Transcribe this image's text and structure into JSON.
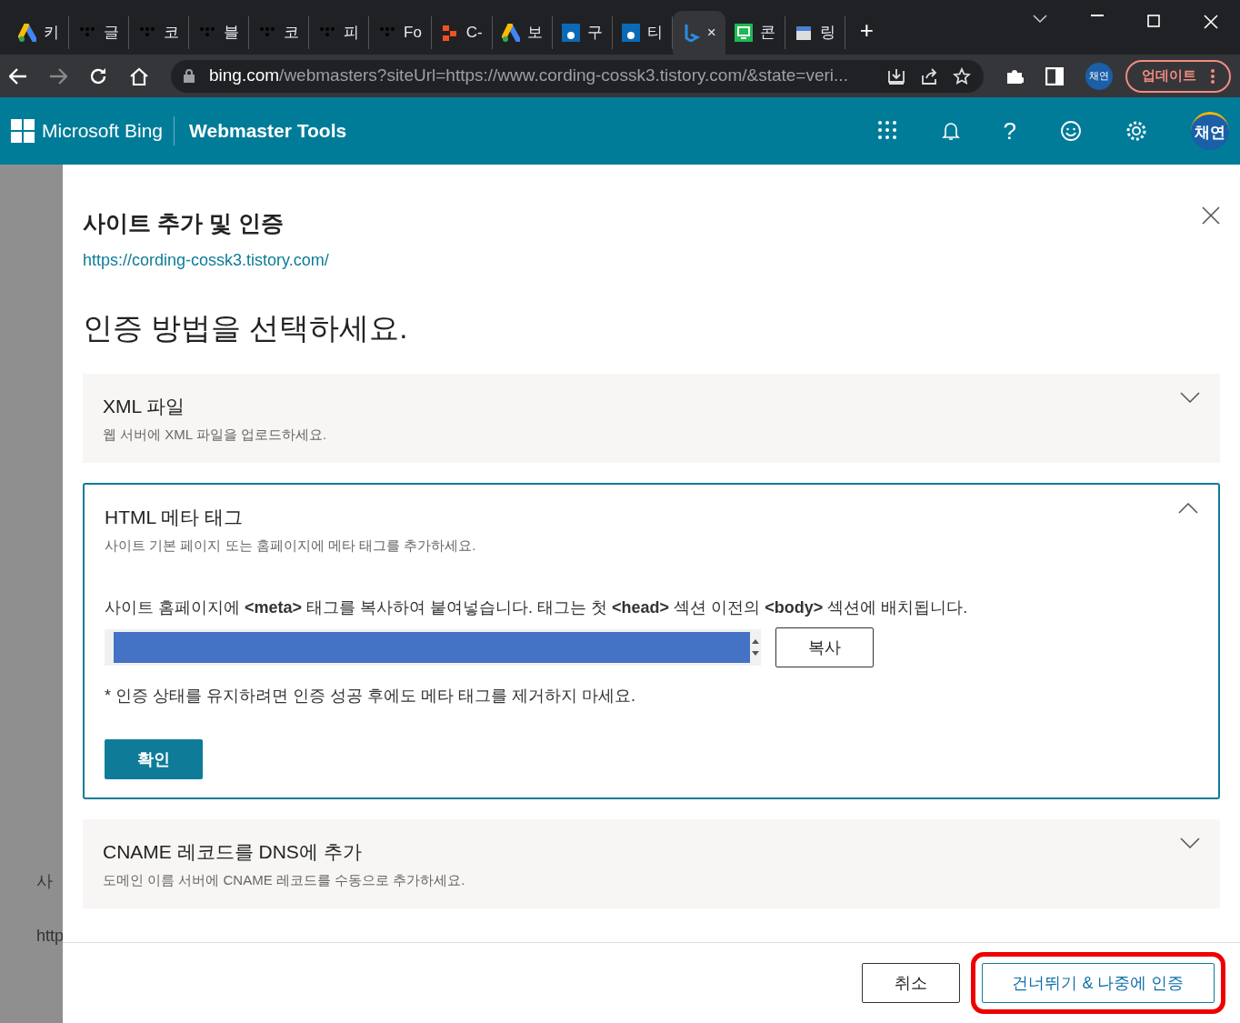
{
  "browser": {
    "tabs": [
      {
        "kind": "ads",
        "label": "키",
        "selected": false
      },
      {
        "kind": "dots",
        "label": "글",
        "selected": false
      },
      {
        "kind": "dots",
        "label": "코",
        "selected": false
      },
      {
        "kind": "dots",
        "label": "블",
        "selected": false
      },
      {
        "kind": "dots",
        "label": "코",
        "selected": false
      },
      {
        "kind": "dots",
        "label": "피",
        "selected": false
      },
      {
        "kind": "dots",
        "label": "Fo",
        "selected": false
      },
      {
        "kind": "blocks",
        "label": "C-",
        "selected": false
      },
      {
        "kind": "ads",
        "label": "보",
        "selected": false
      },
      {
        "kind": "edu",
        "label": "구",
        "selected": false
      },
      {
        "kind": "edu",
        "label": "티",
        "selected": false
      },
      {
        "kind": "bing",
        "label": "×",
        "selected": true
      },
      {
        "kind": "pc",
        "label": "콘",
        "selected": false
      },
      {
        "kind": "store",
        "label": "링",
        "selected": false
      }
    ],
    "new_tab": "+",
    "url_host": "bing.com",
    "url_rest": "/webmasters?siteUrl=https://www.cording-cossk3.tistory.com/&state=veri...",
    "profile": "채연",
    "update_button": "업데이트"
  },
  "app_header": {
    "brand": "Microsoft Bing",
    "product": "Webmaster Tools",
    "help": "?",
    "avatar": "채연"
  },
  "background": {
    "texts": [
      "사",
      "http"
    ]
  },
  "dialog": {
    "title": "사이트 추가 및 인증",
    "site_url": "https://cording-cossk3.tistory.com/",
    "heading": "인증 방법을 선택하세요.",
    "methods": [
      {
        "title": "XML 파일",
        "description": "웹 서버에 XML 파일을 업로드하세요.",
        "expanded": false
      },
      {
        "title": "HTML 메타 태그",
        "description": "사이트 기본 페이지 또는 홈페이지에 메타 태그를 추가하세요.",
        "expanded": true,
        "instruction": "사이트 홈페이지에 **<meta>** 태그를 복사하여 붙여넣습니다. 태그는 첫 **<head>** 섹션 이전의 **<body>** 섹션에 배치됩니다.",
        "copy_button": "복사",
        "note": "* 인증 상태를 유지하려면 인증 성공 후에도 메타 태그를 제거하지 마세요.",
        "confirm_button": "확인"
      },
      {
        "title": "CNAME 레코드를 DNS에 추가",
        "description": "도메인 이름 서버에 CNAME 레코드를 수동으로 추가하세요.",
        "expanded": false
      }
    ],
    "cancel_button": "취소",
    "skip_button": {
      "label": "건너뛰기 & 나중에 인증",
      "highlighted": true
    }
  }
}
